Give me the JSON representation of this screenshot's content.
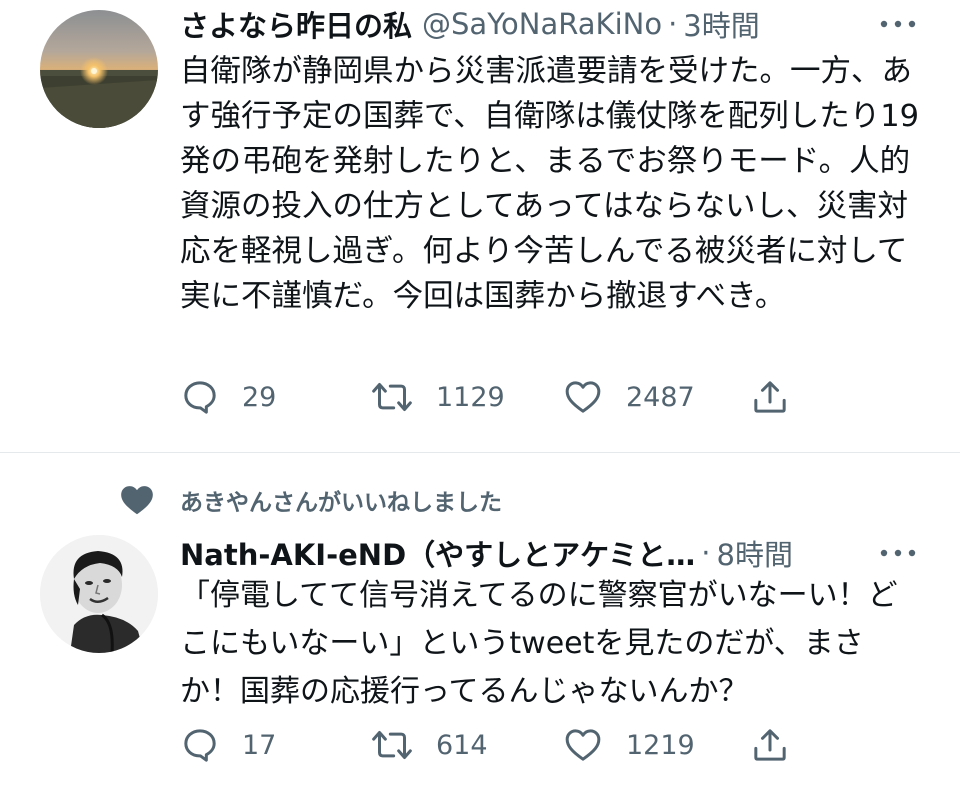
{
  "colors": {
    "text": "#0f1419",
    "secondary": "#536471",
    "divider": "#e6e9ec"
  },
  "tweets": [
    {
      "display_name": "さよなら昨日の私",
      "handle": "@SaYoNaRaKiNo",
      "separator": "·",
      "time": "3時間",
      "text": "自衛隊が静岡県から災害派遣要請を受けた。一方、あす強行予定の国葬で、自衛隊は儀仗隊を配列したり19発の弔砲を発射したりと、まるでお祭りモード。人的資源の投入の仕方としてあってはならないし、災害対応を軽視し過ぎ。何より今苦しんでる被災者に対して実に不謹慎だ。今回は国葬から撤退すべき。",
      "reply_count": "29",
      "retweet_count": "1129",
      "like_count": "2487"
    },
    {
      "social_context": "あきやんさんがいいねしました",
      "display_name": "Nath-AKI-eND（やすしとアケミと…",
      "separator": "·",
      "time": "8時間",
      "text": "「停電してて信号消えてるのに警察官がいなーい！どこにもいなーい」というtweetを見たのだが、まさか！国葬の応援行ってるんじゃないんか？",
      "reply_count": "17",
      "retweet_count": "614",
      "like_count": "1219"
    }
  ]
}
